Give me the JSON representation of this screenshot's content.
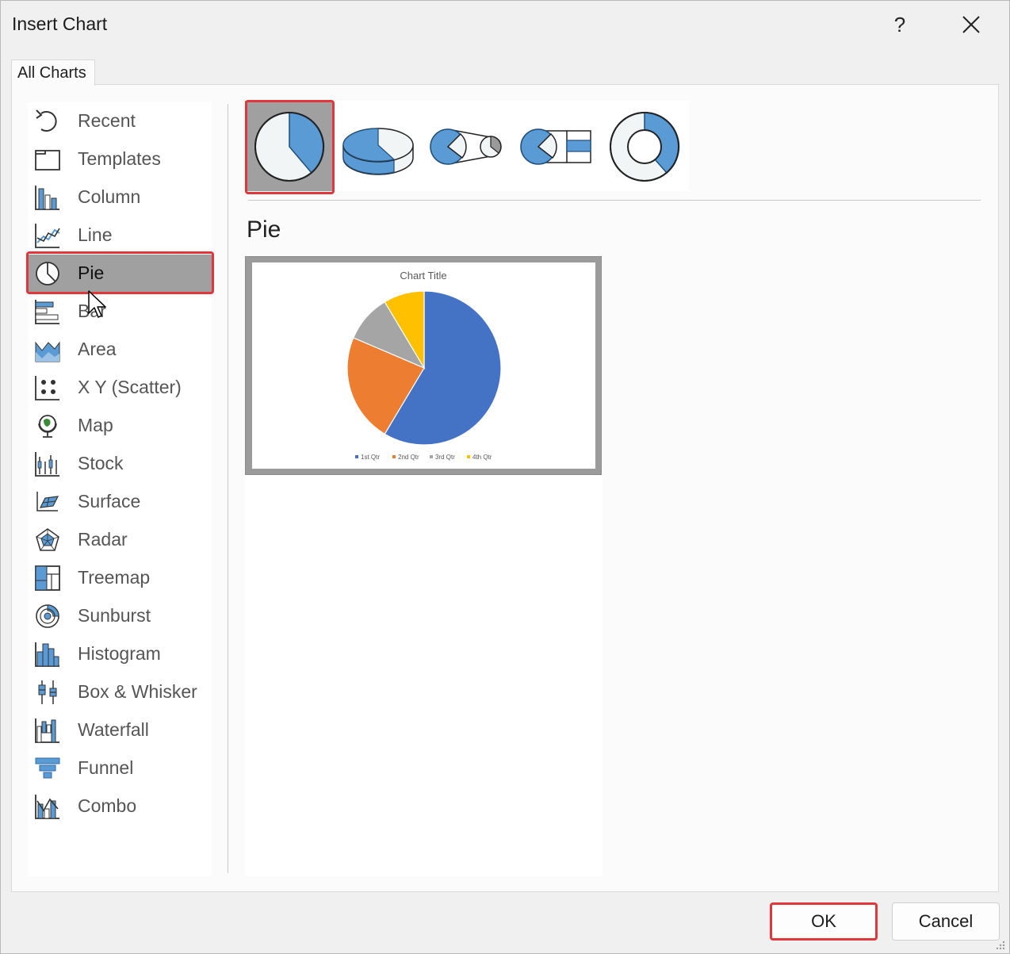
{
  "window": {
    "title": "Insert Chart",
    "help_label": "?"
  },
  "tabs": [
    {
      "label": "All Charts"
    }
  ],
  "chart_types": [
    {
      "label": "Recent",
      "icon": "recent-icon"
    },
    {
      "label": "Templates",
      "icon": "templates-icon"
    },
    {
      "label": "Column",
      "icon": "column-chart-icon"
    },
    {
      "label": "Line",
      "icon": "line-chart-icon"
    },
    {
      "label": "Pie",
      "icon": "pie-chart-icon",
      "selected": true
    },
    {
      "label": "Bar",
      "icon": "bar-chart-icon"
    },
    {
      "label": "Area",
      "icon": "area-chart-icon"
    },
    {
      "label": "X Y (Scatter)",
      "icon": "scatter-chart-icon"
    },
    {
      "label": "Map",
      "icon": "map-chart-icon"
    },
    {
      "label": "Stock",
      "icon": "stock-chart-icon"
    },
    {
      "label": "Surface",
      "icon": "surface-chart-icon"
    },
    {
      "label": "Radar",
      "icon": "radar-chart-icon"
    },
    {
      "label": "Treemap",
      "icon": "treemap-chart-icon"
    },
    {
      "label": "Sunburst",
      "icon": "sunburst-chart-icon"
    },
    {
      "label": "Histogram",
      "icon": "histogram-chart-icon"
    },
    {
      "label": "Box & Whisker",
      "icon": "box-whisker-chart-icon"
    },
    {
      "label": "Waterfall",
      "icon": "waterfall-chart-icon"
    },
    {
      "label": "Funnel",
      "icon": "funnel-chart-icon"
    },
    {
      "label": "Combo",
      "icon": "combo-chart-icon"
    }
  ],
  "subtypes": [
    {
      "icon": "pie-subtype-icon",
      "selected": true
    },
    {
      "icon": "3d-pie-subtype-icon"
    },
    {
      "icon": "pie-of-pie-subtype-icon"
    },
    {
      "icon": "bar-of-pie-subtype-icon"
    },
    {
      "icon": "doughnut-subtype-icon"
    }
  ],
  "selected_type_name": "Pie",
  "chart_data": {
    "type": "pie",
    "title": "Chart Title",
    "categories": [
      "1st Qtr",
      "2nd Qtr",
      "3rd Qtr",
      "4th Qtr"
    ],
    "values": [
      8.2,
      3.2,
      1.4,
      1.2
    ],
    "colors": [
      "#4472c4",
      "#ed7d31",
      "#a5a5a5",
      "#ffc000"
    ],
    "legend": "bottom"
  },
  "buttons": {
    "ok": "OK",
    "cancel": "Cancel"
  },
  "colors": {
    "accent_blue": "#5b9bd5",
    "selection_gray": "#a0a0a0",
    "highlight_red": "#e0373d"
  }
}
